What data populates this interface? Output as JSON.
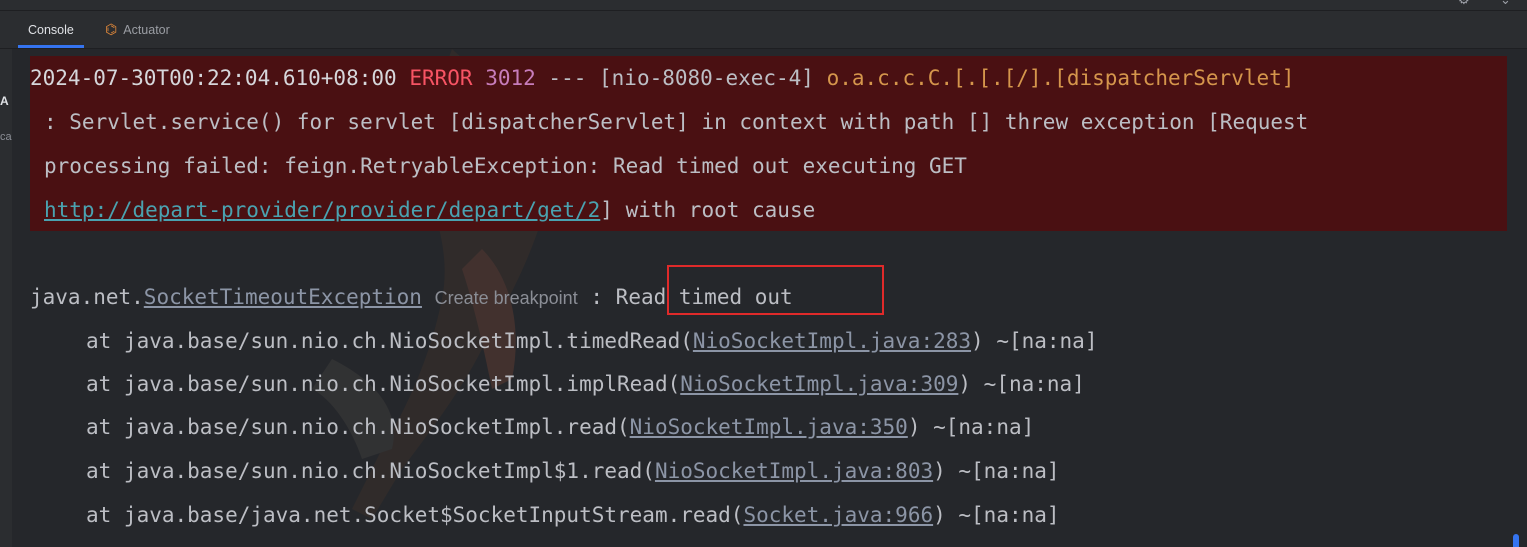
{
  "tabs": [
    {
      "label": "Console",
      "active": true
    },
    {
      "label": "Actuator",
      "icon": "actuator-icon",
      "active": false
    }
  ],
  "left_gutter": [
    "A",
    "ca"
  ],
  "error_block": {
    "line1": {
      "timestamp": "2024-07-30T00:22:04.610+08:00",
      "level": "ERROR",
      "pid": "3012",
      "sep": "---",
      "thread": "[nio-8080-exec-4]",
      "logger": "o.a.c.c.C.[.[.[/].[dispatcherServlet]"
    },
    "line2": ": Servlet.service() for servlet [dispatcherServlet] in context with path [] threw exception [Request",
    "line3": "processing failed: feign.RetryableException: Read timed out executing GET",
    "line4": {
      "url": "http://depart-provider/provider/depart/get/2",
      "rest": "] with root cause"
    }
  },
  "exception": {
    "package": "java.net.",
    "class_name": "SocketTimeoutException",
    "breakpoint_label": "Create breakpoint",
    "separator": ":",
    "message": "Read timed out"
  },
  "stack_frames": [
    {
      "prefix": "at java.base/sun.nio.ch.NioSocketImpl.timedRead(",
      "link": "NioSocketImpl.java:283",
      "suffix": ") ~[na:na]"
    },
    {
      "prefix": "at java.base/sun.nio.ch.NioSocketImpl.implRead(",
      "link": "NioSocketImpl.java:309",
      "suffix": ") ~[na:na]"
    },
    {
      "prefix": "at java.base/sun.nio.ch.NioSocketImpl.read(",
      "link": "NioSocketImpl.java:350",
      "suffix": ") ~[na:na]"
    },
    {
      "prefix": "at java.base/sun.nio.ch.NioSocketImpl$1.read(",
      "link": "NioSocketImpl.java:803",
      "suffix": ") ~[na:na]"
    },
    {
      "prefix": "at java.base/java.net.Socket$SocketInputStream.read(",
      "link": "Socket.java:966",
      "suffix": ") ~[na:na]"
    }
  ],
  "colors": {
    "error_background": "#4a1012",
    "error_level": "#f75464",
    "logger": "#d5964c",
    "link": "#4aa2b0",
    "highlight_border": "#e02a2a",
    "accent": "#3574f0"
  }
}
